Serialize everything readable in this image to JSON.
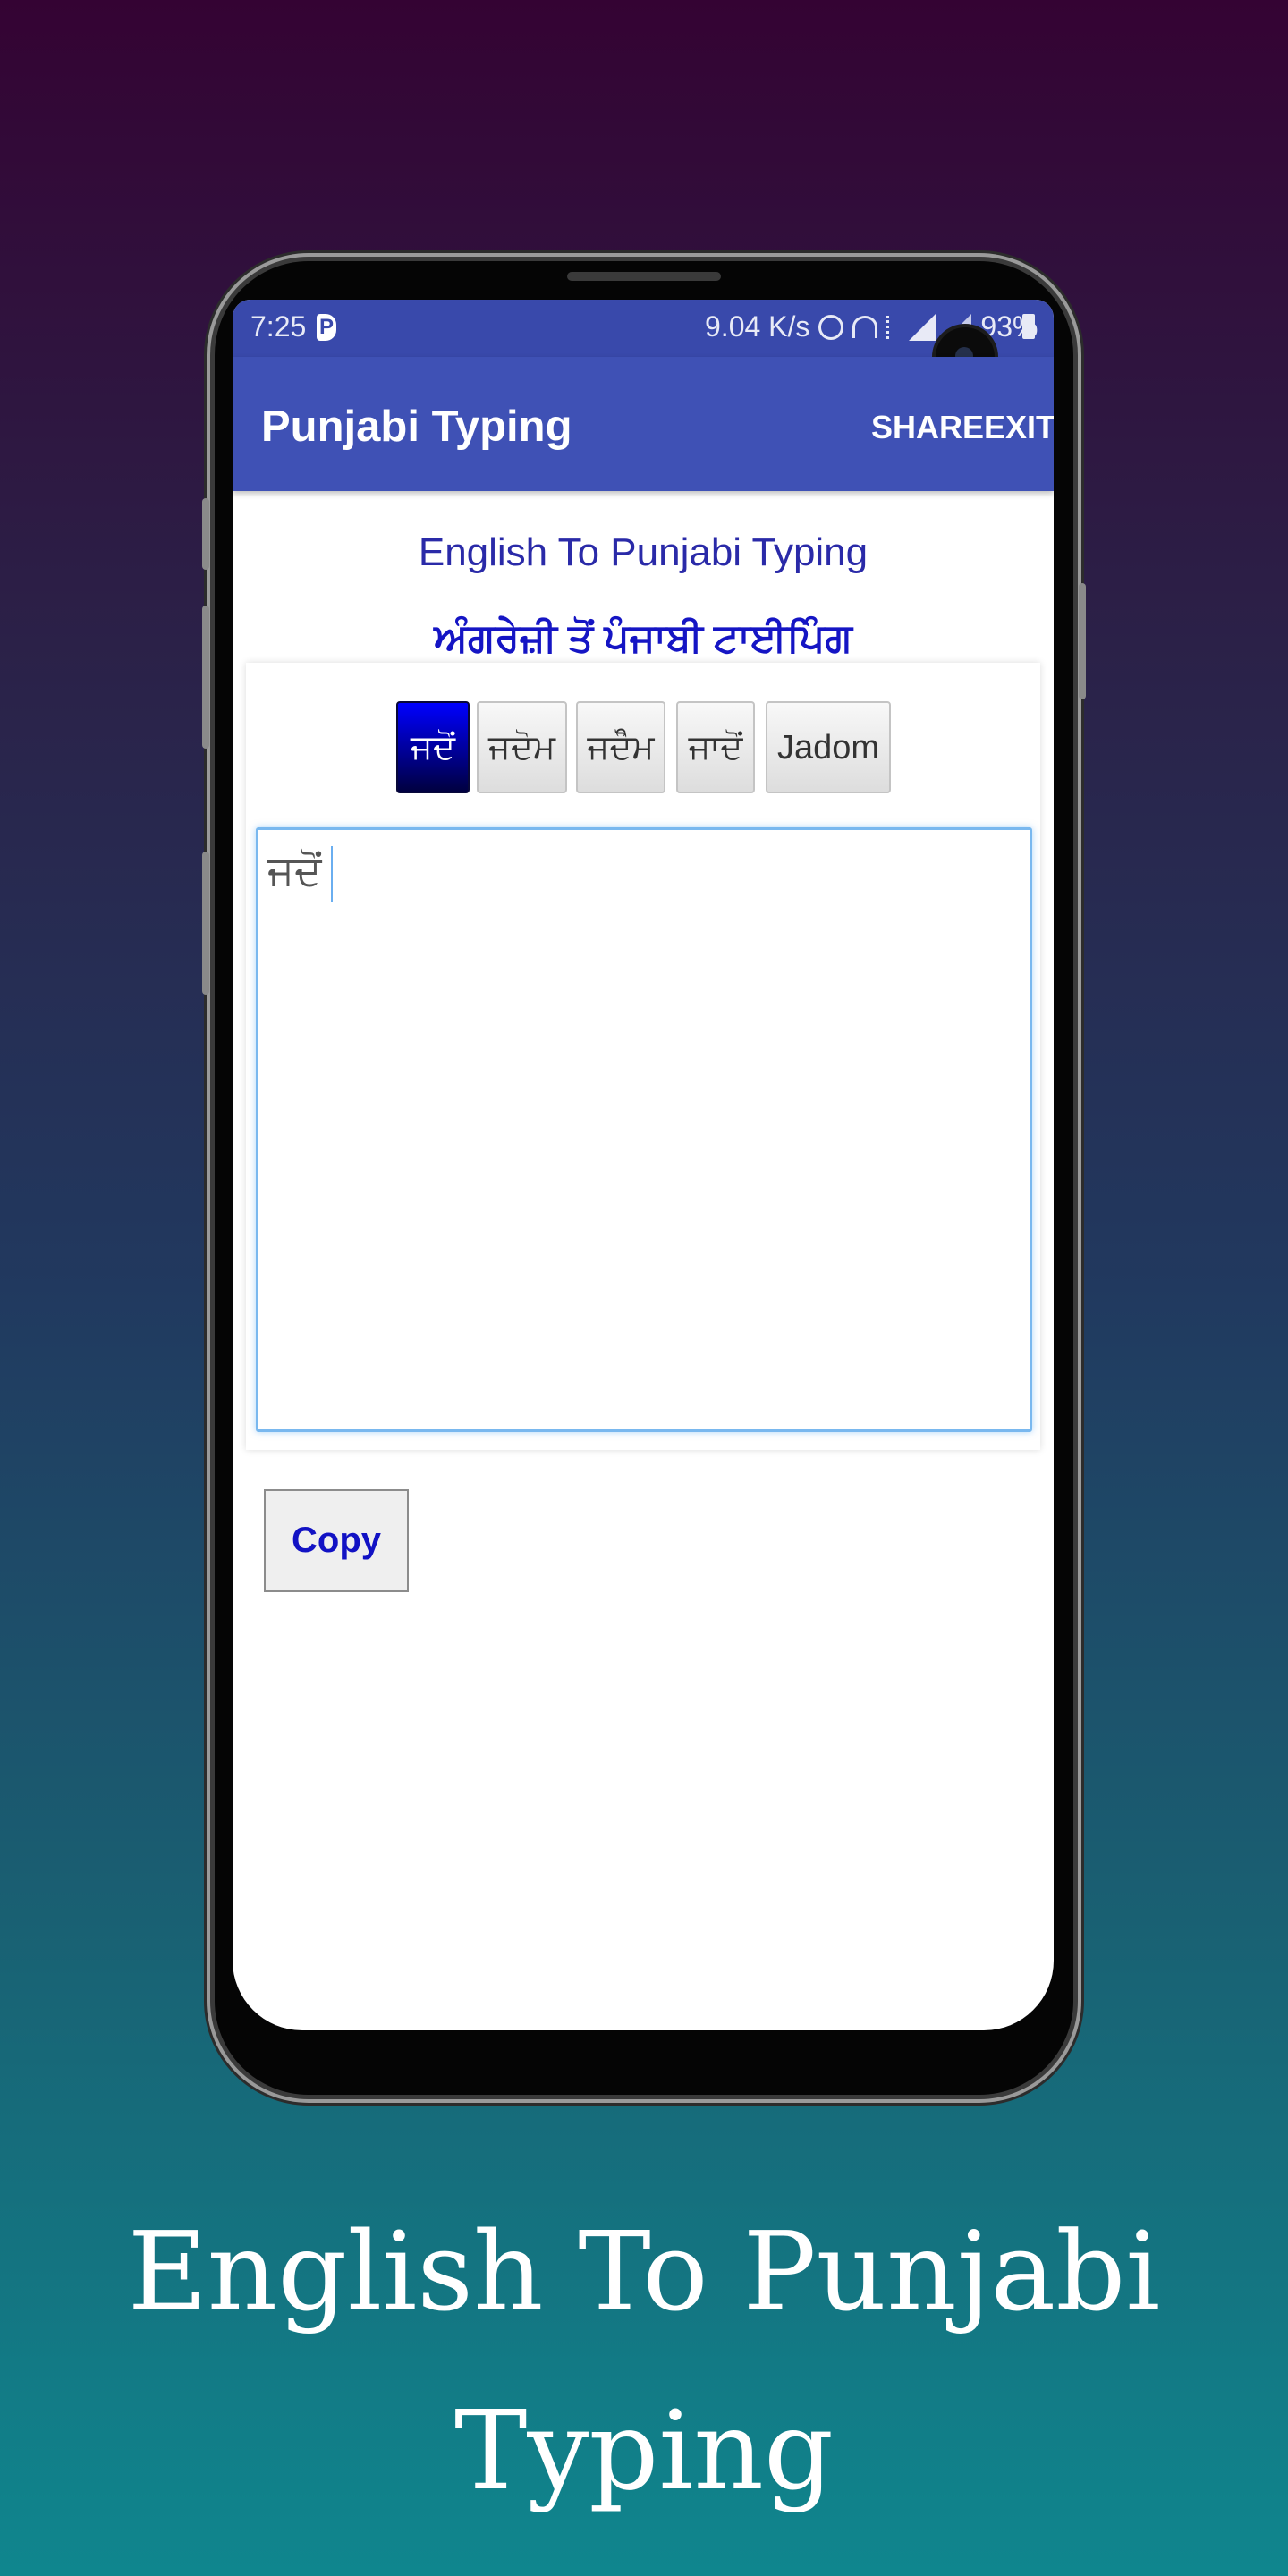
{
  "status_bar": {
    "time": "7:25",
    "app_indicator": "P",
    "speed": "9.04 K/s",
    "battery": "93%",
    "icons": [
      "alarm-icon",
      "hotspot-icon",
      "data-icon",
      "signal-icon",
      "signal-icon",
      "battery-icon"
    ]
  },
  "app_bar": {
    "title": "Punjabi Typing",
    "share_label": "SHARE",
    "exit_label": "EXIT",
    "color": "#3f51b5",
    "status_color": "#3949ab"
  },
  "content": {
    "heading_en": "English To Punjabi Typing",
    "heading_pa": "ਅੰਗਰੇਜ਼ੀ ਤੋਂ ਪੰਜਾਬੀ ਟਾਈਪਿੰਗ",
    "suggestions": [
      "ਜਦੋਂ",
      "ਜਦੋਮ",
      "ਜਦੋੰਮ",
      "ਜਾਦੋਂ",
      "Jadom"
    ],
    "selected_suggestion": "ਜਦੋਂ",
    "text_value": "ਜਦੋਂ",
    "copy_label": "Copy"
  },
  "caption": {
    "line1": "English To Punjabi",
    "line2": "Typing"
  }
}
